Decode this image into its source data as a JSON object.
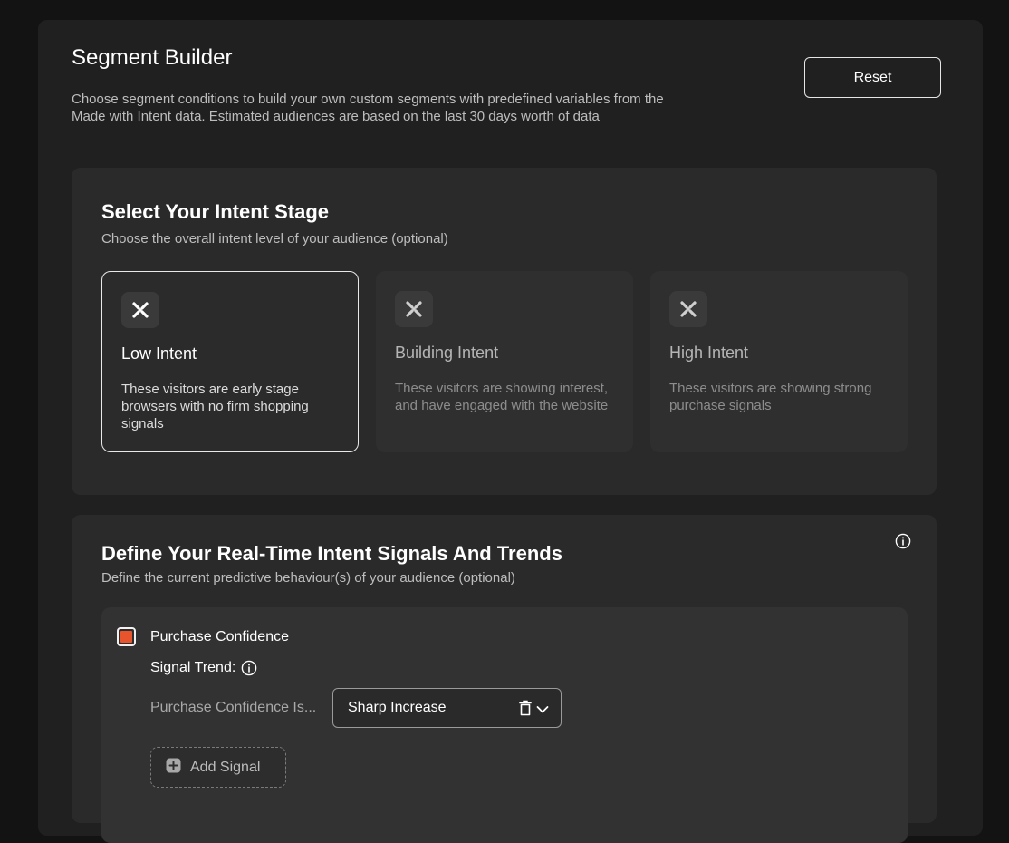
{
  "header": {
    "title": "Segment Builder",
    "description": "Choose segment conditions to build your own custom segments with predefined variables from the Made with Intent data. Estimated audiences are based on the last 30 days worth of data",
    "reset_label": "Reset"
  },
  "intent_stage": {
    "title": "Select Your Intent Stage",
    "subtitle": "Choose the overall intent level of your audience (optional)",
    "options": [
      {
        "title": "Low Intent",
        "description": "These visitors are early stage browsers with no firm shopping signals",
        "selected": true,
        "icon": "x-icon"
      },
      {
        "title": "Building Intent",
        "description": "These visitors are showing interest, and have engaged with the website",
        "selected": false,
        "icon": "x-icon"
      },
      {
        "title": "High Intent",
        "description": "These visitors are showing strong purchase signals",
        "selected": false,
        "icon": "x-icon"
      }
    ]
  },
  "signals": {
    "title": "Define Your Real-Time Intent Signals And Trends",
    "subtitle": "Define the current predictive behaviour(s) of your audience (optional)",
    "info_icon": "info-icon",
    "items": [
      {
        "name": "Purchase Confidence",
        "checked": true,
        "checkbox_color": "#e8542b",
        "trend_label": "Signal Trend:",
        "condition_label": "Purchase Confidence Is...",
        "selected_value": "Sharp Increase"
      }
    ],
    "add_signal_label": "Add Signal"
  },
  "colors": {
    "background": "#131313",
    "panel": "#202020",
    "card": "#2a2a2a",
    "accent": "#e8542b"
  }
}
